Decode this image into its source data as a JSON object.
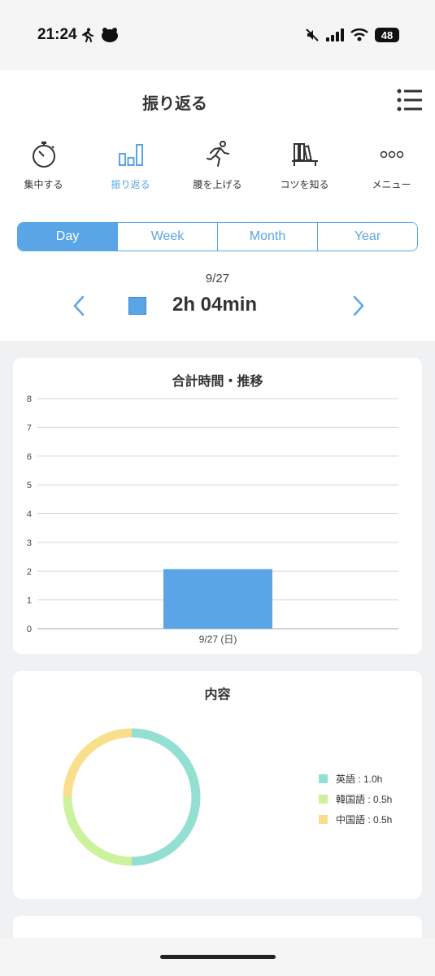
{
  "status_bar": {
    "time": "21:24",
    "battery": "48"
  },
  "header": {
    "title": "振り返る",
    "nav": [
      {
        "label": "集中する",
        "icon": "stopwatch-icon",
        "active": false
      },
      {
        "label": "振り返る",
        "icon": "bar-chart-icon",
        "active": true
      },
      {
        "label": "腰を上げる",
        "icon": "running-person-icon",
        "active": false
      },
      {
        "label": "コツを知る",
        "icon": "bookshelf-icon",
        "active": false
      },
      {
        "label": "メニュー",
        "icon": "more-dots-icon",
        "active": false
      }
    ]
  },
  "period_tabs": [
    "Day",
    "Week",
    "Month",
    "Year"
  ],
  "selected_period": "Day",
  "summary": {
    "date": "9/27",
    "total": "2h 04min",
    "color": "#5aa5e6"
  },
  "bar_card": {
    "title": "合計時間・推移"
  },
  "donut_card": {
    "title": "内容"
  },
  "colors": {
    "accent": "#5aa5e6",
    "english": "#93dfd2",
    "korean": "#cdf29e",
    "chinese": "#f8df8b"
  },
  "chart_data": [
    {
      "type": "bar",
      "title": "合計時間・推移",
      "categories": [
        "9/27 (日)"
      ],
      "values": [
        2.07
      ],
      "ylim": [
        0,
        8
      ],
      "yticks": [
        "0",
        "1",
        "2",
        "3",
        "4",
        "5",
        "6",
        "7",
        "8"
      ],
      "grid": true,
      "color": "#5aa5e6"
    },
    {
      "type": "pie",
      "title": "内容",
      "donut": true,
      "legend_position": "right",
      "slices": [
        {
          "name": "英語",
          "value": 1.0,
          "label": "英語 : 1.0h",
          "color": "#93dfd2"
        },
        {
          "name": "韓国語",
          "value": 0.5,
          "label": "韓国語 : 0.5h",
          "color": "#cdf29e"
        },
        {
          "name": "中国語",
          "value": 0.5,
          "label": "中国語 : 0.5h",
          "color": "#f8df8b"
        }
      ]
    }
  ]
}
